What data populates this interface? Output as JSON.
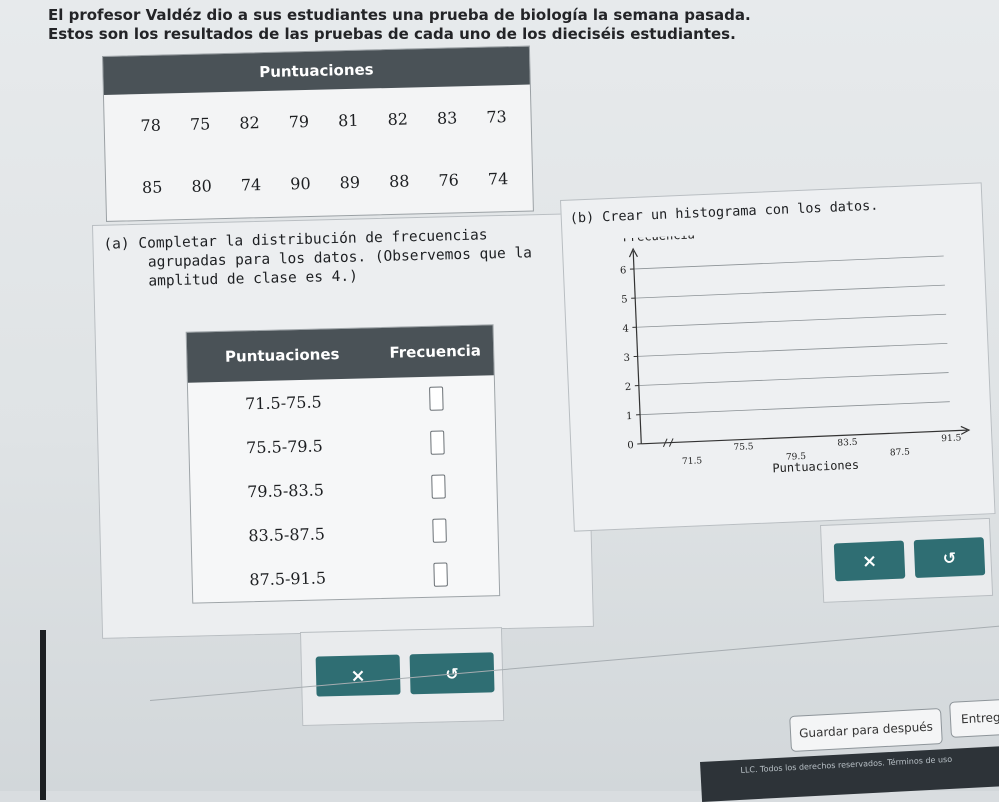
{
  "intro": {
    "line1": "El profesor Valdéz dio a sus estudiantes una prueba de biología la semana pasada.",
    "line2": "Estos son los resultados de las pruebas de cada uno de los dieciséis estudiantes."
  },
  "scores_table": {
    "header": "Puntuaciones",
    "row1": [
      "78",
      "75",
      "82",
      "79",
      "81",
      "82",
      "83",
      "73"
    ],
    "row2": [
      "85",
      "80",
      "74",
      "90",
      "89",
      "88",
      "76",
      "74"
    ]
  },
  "part_a": {
    "line1": "(a) Completar la distribución de frecuencias",
    "line2": "agrupadas para los datos. (Observemos que la",
    "line3": "amplitud de clase es 4.)",
    "col_scores": "Puntuaciones",
    "col_freq": "Frecuencia",
    "classes": [
      "71.5-75.5",
      "75.5-79.5",
      "79.5-83.5",
      "83.5-87.5",
      "87.5-91.5"
    ],
    "frequencies": [
      "",
      "",
      "",
      "",
      ""
    ]
  },
  "part_b": {
    "prompt": "(b) Crear un histograma con los datos.",
    "y_label": "Frecuencia",
    "x_label": "Puntuaciones"
  },
  "chart_data": {
    "type": "bar",
    "categories": [
      "71.5-75.5",
      "75.5-79.5",
      "79.5-83.5",
      "83.5-87.5",
      "87.5-91.5"
    ],
    "values": [],
    "xticks": [
      "71.5",
      "75.5",
      "79.5",
      "83.5",
      "87.5",
      "91.5"
    ],
    "yticks": [
      "0",
      "1",
      "2",
      "3",
      "4",
      "5",
      "6"
    ],
    "xlabel": "Puntuaciones",
    "ylabel": "Frecuencia",
    "ylim": [
      0,
      6
    ]
  },
  "buttons": {
    "clear": "×",
    "undo": "↺",
    "save": "Guardar para después",
    "submit": "Entrega"
  },
  "footer": {
    "text": "LLC. Todos los derechos reservados.  Términos de uso"
  },
  "colors": {
    "header_bg": "#4a5257",
    "button_bg": "#2f6e73",
    "page_bg": "#dfe3e5"
  }
}
